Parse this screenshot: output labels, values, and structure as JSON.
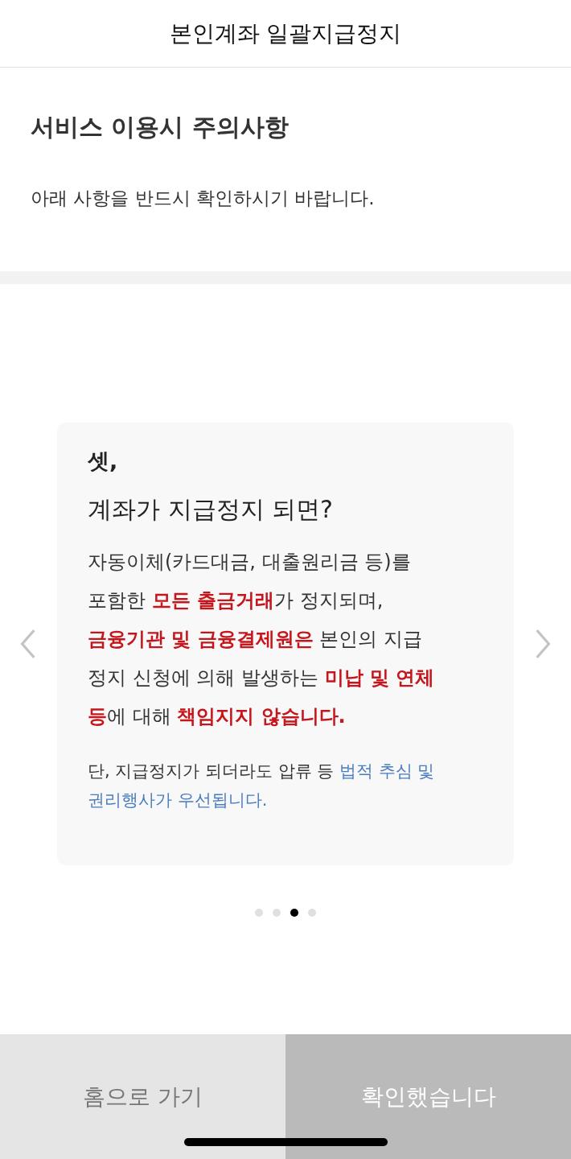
{
  "header": {
    "title": "본인계좌 일괄지급정지"
  },
  "notice": {
    "title": "서비스 이용시 주의사항",
    "subtitle": "아래 사항을 반드시 확인하시기 바랍니다."
  },
  "card": {
    "eyebrow": "셋,",
    "heading": "계좌가 지급정지 되면?",
    "body_lines": [
      [
        {
          "text": "자동이체(카드대금, 대출원리금 등)를",
          "kind": "plain"
        }
      ],
      [
        {
          "text": "포함한 ",
          "kind": "plain"
        },
        {
          "text": "모든 출금거래",
          "kind": "alert"
        },
        {
          "text": "가 정지되며,",
          "kind": "plain"
        }
      ],
      [
        {
          "text": "금융기관 및 금융결제원은",
          "kind": "alert"
        },
        {
          "text": " 본인의 지급",
          "kind": "plain"
        }
      ],
      [
        {
          "text": "정지 신청에 의해 발생하는 ",
          "kind": "plain"
        },
        {
          "text": "미납 및 연체",
          "kind": "alert"
        }
      ],
      [
        {
          "text": "등",
          "kind": "alert"
        },
        {
          "text": "에 대해 ",
          "kind": "plain"
        },
        {
          "text": "책임지지 않습니다.",
          "kind": "alert"
        }
      ]
    ],
    "note_lines": [
      [
        {
          "text": "단, 지급정지가 되더라도 압류 등 ",
          "kind": "plain"
        },
        {
          "text": "법적 추심 및",
          "kind": "link"
        }
      ],
      [
        {
          "text": "권리행사가 우선됩니다.",
          "kind": "link"
        }
      ]
    ]
  },
  "pager": [
    {
      "selected": false
    },
    {
      "selected": false
    },
    {
      "selected": true
    },
    {
      "selected": false
    }
  ],
  "buttons": [
    {
      "label": "홈으로 가기",
      "disabled": false
    },
    {
      "label": "확인했습니다",
      "disabled": true
    }
  ]
}
